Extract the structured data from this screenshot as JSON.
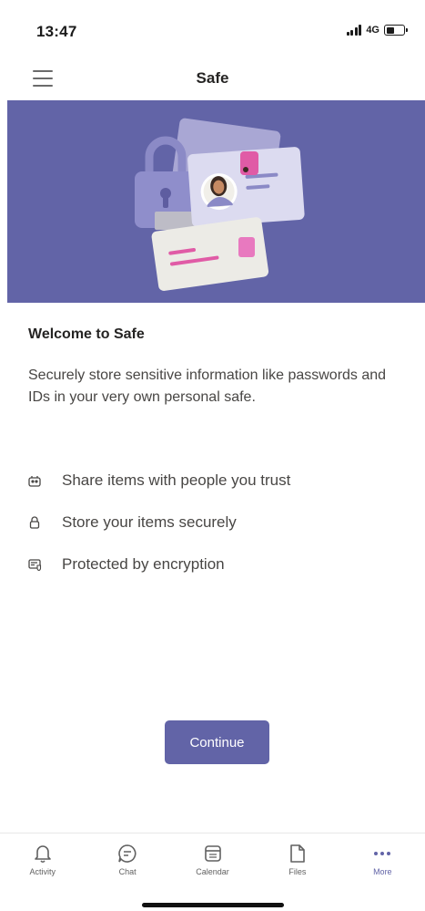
{
  "status_bar": {
    "time": "13:47",
    "network": "4G",
    "battery_level": 0.45
  },
  "header": {
    "title": "Safe",
    "menu_icon": "hamburger-menu-icon"
  },
  "hero": {
    "background_color": "#6264a7",
    "illustration": "safe-illustration"
  },
  "welcome": {
    "title": "Welcome to Safe",
    "description": "Securely store sensitive information like passwords and IDs in your very own personal safe."
  },
  "features": [
    {
      "icon": "share-people-icon",
      "label": "Share items with people you trust"
    },
    {
      "icon": "lock-icon",
      "label": "Store your items securely"
    },
    {
      "icon": "shield-card-icon",
      "label": "Protected by encryption"
    }
  ],
  "continue_button": {
    "label": "Continue",
    "color": "#6264a7"
  },
  "bottom_nav": {
    "items": [
      {
        "label": "Activity",
        "icon": "bell-icon",
        "active": false
      },
      {
        "label": "Chat",
        "icon": "chat-icon",
        "active": false
      },
      {
        "label": "Calendar",
        "icon": "calendar-icon",
        "active": false
      },
      {
        "label": "Files",
        "icon": "file-icon",
        "active": false
      },
      {
        "label": "More",
        "icon": "more-dots-icon",
        "active": true
      }
    ]
  }
}
